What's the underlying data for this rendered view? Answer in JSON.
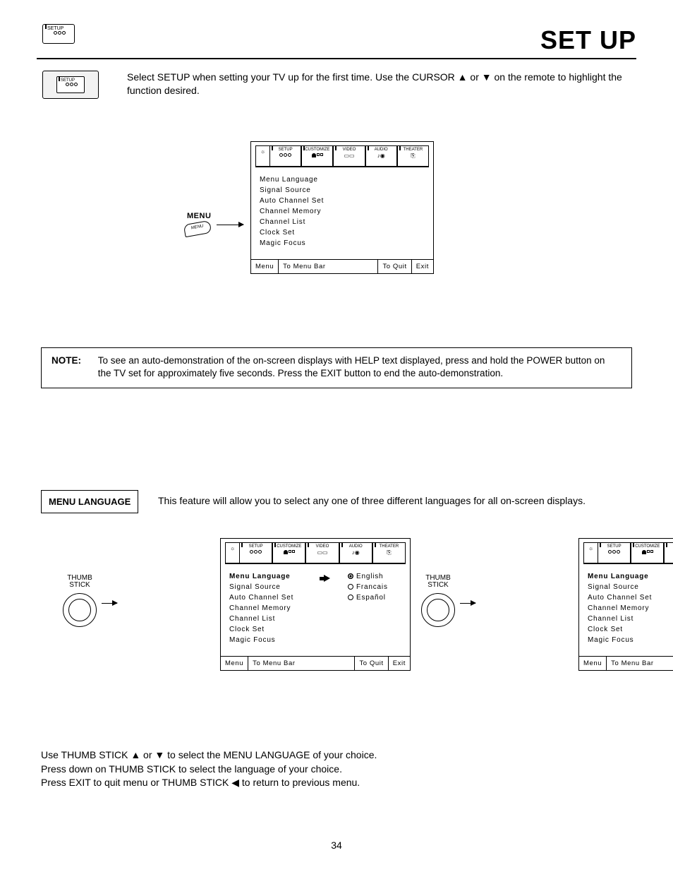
{
  "header": {
    "setup_small": "SETUP",
    "page_title": "SET UP"
  },
  "intro": {
    "setup_box": "SETUP",
    "text": "Select SETUP when setting your TV up for the first time.  Use the CURSOR ▲ or ▼ on the remote to highlight the function desired."
  },
  "menu_key": {
    "label": "MENU",
    "key": "MENU"
  },
  "tabs": [
    "SETUP",
    "CUSTOMIZE",
    "VIDEO",
    "AUDIO",
    "THEATER"
  ],
  "setup_items": [
    "Menu Language",
    "Signal Source",
    "Auto Channel Set",
    "Channel Memory",
    "Channel List",
    "Clock Set",
    "Magic Focus"
  ],
  "osd_footer": {
    "menu": "Menu",
    "bar": "To Menu Bar",
    "quit": "To Quit",
    "exit": "Exit"
  },
  "note": {
    "label": "NOTE:",
    "text": "To see an auto-demonstration of the on-screen displays with HELP text displayed, press and hold the POWER button on the TV set for approximately five seconds. Press the EXIT button to end the auto-demonstration."
  },
  "menu_language": {
    "heading": "MENU LANGUAGE",
    "intro": "This feature will allow you to select any one of three different languages for all on-screen displays."
  },
  "thumb": {
    "line1": "THUMB",
    "line2": "STICK"
  },
  "languages": [
    "English",
    "Francais",
    "Español"
  ],
  "instructions": [
    "Use THUMB STICK ▲ or ▼ to select the MENU LANGUAGE of your choice.",
    "Press down on THUMB STICK to select the language of your choice.",
    "Press EXIT to quit menu or THUMB STICK ◀ to return to previous menu."
  ],
  "page_number": "34"
}
